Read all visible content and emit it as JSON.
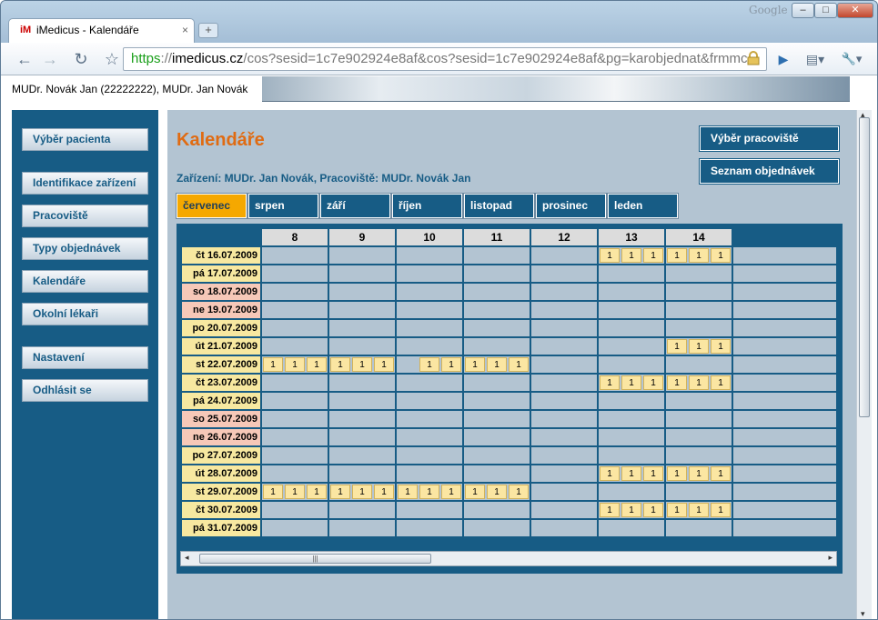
{
  "browser": {
    "brand": "Google",
    "tab_title": "iMedicus - Kalendáře",
    "favicon_text": "iM",
    "tab_close": "×",
    "new_tab": "+",
    "url_scheme": "https",
    "url_host": "imedicus.cz",
    "url_rest": "/cos?sesid=1c7e902924e8af&cos?sesid=1c7e902924e8af&pg=karobjednat&frmmc",
    "window_buttons": [
      "–",
      "□",
      "✕"
    ],
    "back_icon": "←",
    "forward_icon": "→",
    "reload_icon": "↻",
    "star_icon": "☆",
    "play_icon": "▶",
    "page_icon": "▤▾",
    "wrench_icon": "🔧▾"
  },
  "header": {
    "user_text": "MUDr. Novák Jan (22222222), MUDr. Jan Novák"
  },
  "sidebar": {
    "items": [
      {
        "label": "Výběr pacienta"
      },
      {
        "label": "Identifikace zařízení"
      },
      {
        "label": "Pracoviště"
      },
      {
        "label": "Typy objednávek"
      },
      {
        "label": "Kalendáře"
      },
      {
        "label": "Okolní lékaři"
      },
      {
        "label": "Nastavení"
      },
      {
        "label": "Odhlásit se"
      }
    ]
  },
  "main": {
    "title": "Kalendáře",
    "subtitle": "Zařízení: MUDr. Jan Novák, Pracoviště: MUDr. Novák Jan",
    "right_buttons": [
      "Výběr pracoviště",
      "Seznam objednávek"
    ],
    "month_tabs": [
      "červenec",
      "srpen",
      "září",
      "říjen",
      "listopad",
      "prosinec",
      "leden"
    ],
    "active_tab": 0
  },
  "calendar": {
    "hours": [
      "8",
      "9",
      "10",
      "11",
      "12",
      "13",
      "14"
    ],
    "slot_value": "1",
    "rows": [
      {
        "date": "čt 16.07.2009",
        "weekend": false,
        "slots": [
          "",
          "",
          "",
          "",
          "",
          "111",
          "111"
        ]
      },
      {
        "date": "pá 17.07.2009",
        "weekend": false,
        "slots": [
          "",
          "",
          "",
          "",
          "",
          "",
          ""
        ]
      },
      {
        "date": "so 18.07.2009",
        "weekend": true,
        "slots": [
          "",
          "",
          "",
          "",
          "",
          "",
          ""
        ]
      },
      {
        "date": "ne 19.07.2009",
        "weekend": true,
        "slots": [
          "",
          "",
          "",
          "",
          "",
          "",
          ""
        ]
      },
      {
        "date": "po 20.07.2009",
        "weekend": false,
        "slots": [
          "",
          "",
          "",
          "",
          "",
          "",
          ""
        ]
      },
      {
        "date": "út 21.07.2009",
        "weekend": false,
        "slots": [
          "",
          "",
          "",
          "",
          "",
          "",
          "111"
        ]
      },
      {
        "date": "st 22.07.2009",
        "weekend": false,
        "slots": [
          "111",
          "111",
          "011",
          "111",
          "",
          "",
          ""
        ]
      },
      {
        "date": "čt 23.07.2009",
        "weekend": false,
        "slots": [
          "",
          "",
          "",
          "",
          "",
          "111",
          "111"
        ]
      },
      {
        "date": "pá 24.07.2009",
        "weekend": false,
        "slots": [
          "",
          "",
          "",
          "",
          "",
          "",
          ""
        ]
      },
      {
        "date": "so 25.07.2009",
        "weekend": true,
        "slots": [
          "",
          "",
          "",
          "",
          "",
          "",
          ""
        ]
      },
      {
        "date": "ne 26.07.2009",
        "weekend": true,
        "slots": [
          "",
          "",
          "",
          "",
          "",
          "",
          ""
        ]
      },
      {
        "date": "po 27.07.2009",
        "weekend": false,
        "slots": [
          "",
          "",
          "",
          "",
          "",
          "",
          ""
        ]
      },
      {
        "date": "út 28.07.2009",
        "weekend": false,
        "slots": [
          "",
          "",
          "",
          "",
          "",
          "111",
          "111"
        ]
      },
      {
        "date": "st 29.07.2009",
        "weekend": false,
        "slots": [
          "111",
          "111",
          "111",
          "111",
          "",
          "",
          ""
        ]
      },
      {
        "date": "čt 30.07.2009",
        "weekend": false,
        "slots": [
          "",
          "",
          "",
          "",
          "",
          "111",
          "111"
        ]
      },
      {
        "date": "pá 31.07.2009",
        "weekend": false,
        "slots": [
          "",
          "",
          "",
          "",
          "",
          "",
          ""
        ]
      }
    ],
    "hscroll_grip": "|||",
    "scroll_left": "◂",
    "scroll_right": "▸"
  },
  "colors": {
    "accent": "#e06b12",
    "navy": "#175c85",
    "active_tab": "#f5a800",
    "slot": "#fbe6a2",
    "weekend": "#f6c8b8"
  }
}
